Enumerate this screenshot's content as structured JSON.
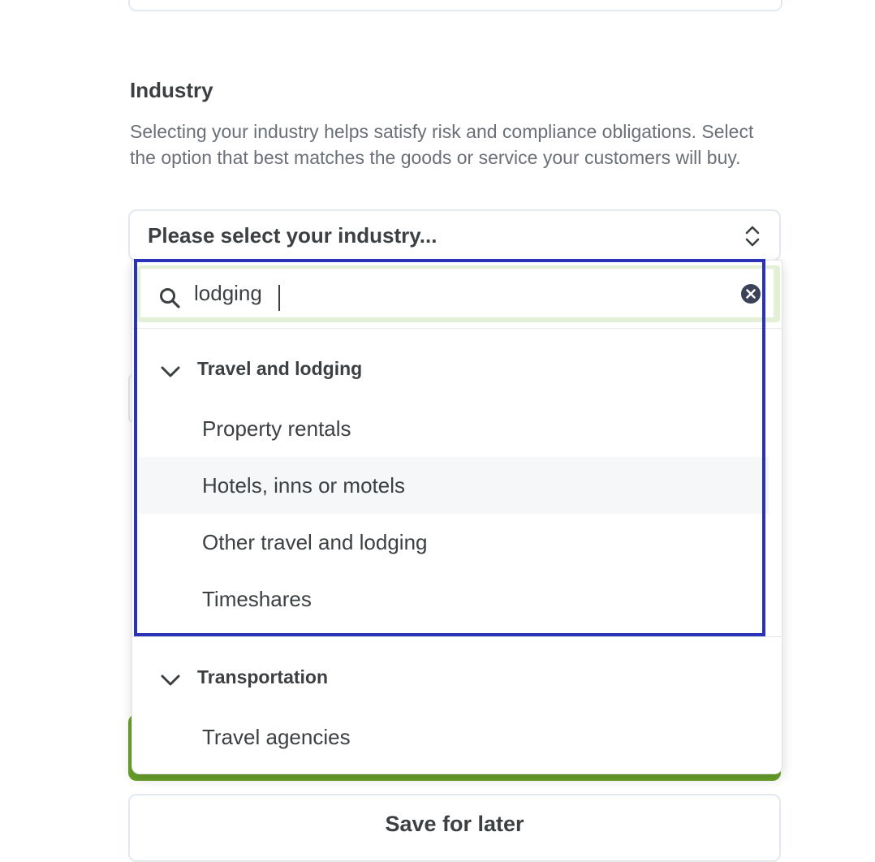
{
  "industry": {
    "title": "Industry",
    "description": "Selecting your industry helps satisfy risk and compliance obligations. Select the option that best matches the goods or service your customers will buy.",
    "select_placeholder": "Please select your industry..."
  },
  "dropdown": {
    "search_value": "lodging",
    "groups": [
      {
        "label": "Travel and lodging",
        "options": [
          "Property rentals",
          "Hotels, inns or motels",
          "Other travel and lodging",
          "Timeshares"
        ]
      },
      {
        "label": "Transportation",
        "options": [
          "Travel agencies"
        ]
      }
    ],
    "hovered_option": "Hotels, inns or motels"
  },
  "footer": {
    "save_later_label": "Save for later"
  },
  "colors": {
    "accent_green": "#6aa22b",
    "highlight_blue": "#2a33b8"
  }
}
